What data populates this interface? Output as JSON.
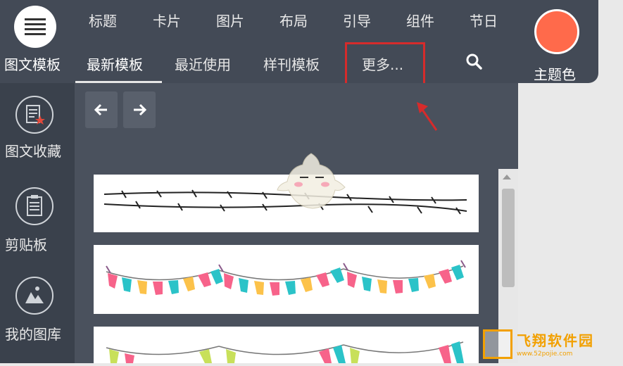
{
  "header": {
    "logo_label": "图文模板",
    "categories": [
      "标题",
      "卡片",
      "图片",
      "布局",
      "引导",
      "组件",
      "节日"
    ],
    "tabs": [
      "最新模板",
      "最近使用",
      "样刊模板",
      "更多..."
    ],
    "theme_label": "主题色"
  },
  "sidebar": {
    "items": [
      {
        "label": "图文收藏",
        "icon": "document-star-icon"
      },
      {
        "label": "剪贴板",
        "icon": "clipboard-icon"
      },
      {
        "label": "我的图库",
        "icon": "image-gallery-icon"
      }
    ]
  },
  "colors": {
    "theme": "#ff6a4b",
    "highlight": "#d62b2b",
    "top_bg": "#434a56",
    "sidebar_bg": "#3a414c"
  },
  "watermark": {
    "text": "飞翔软件园",
    "sub": "www.52pojie.com"
  }
}
